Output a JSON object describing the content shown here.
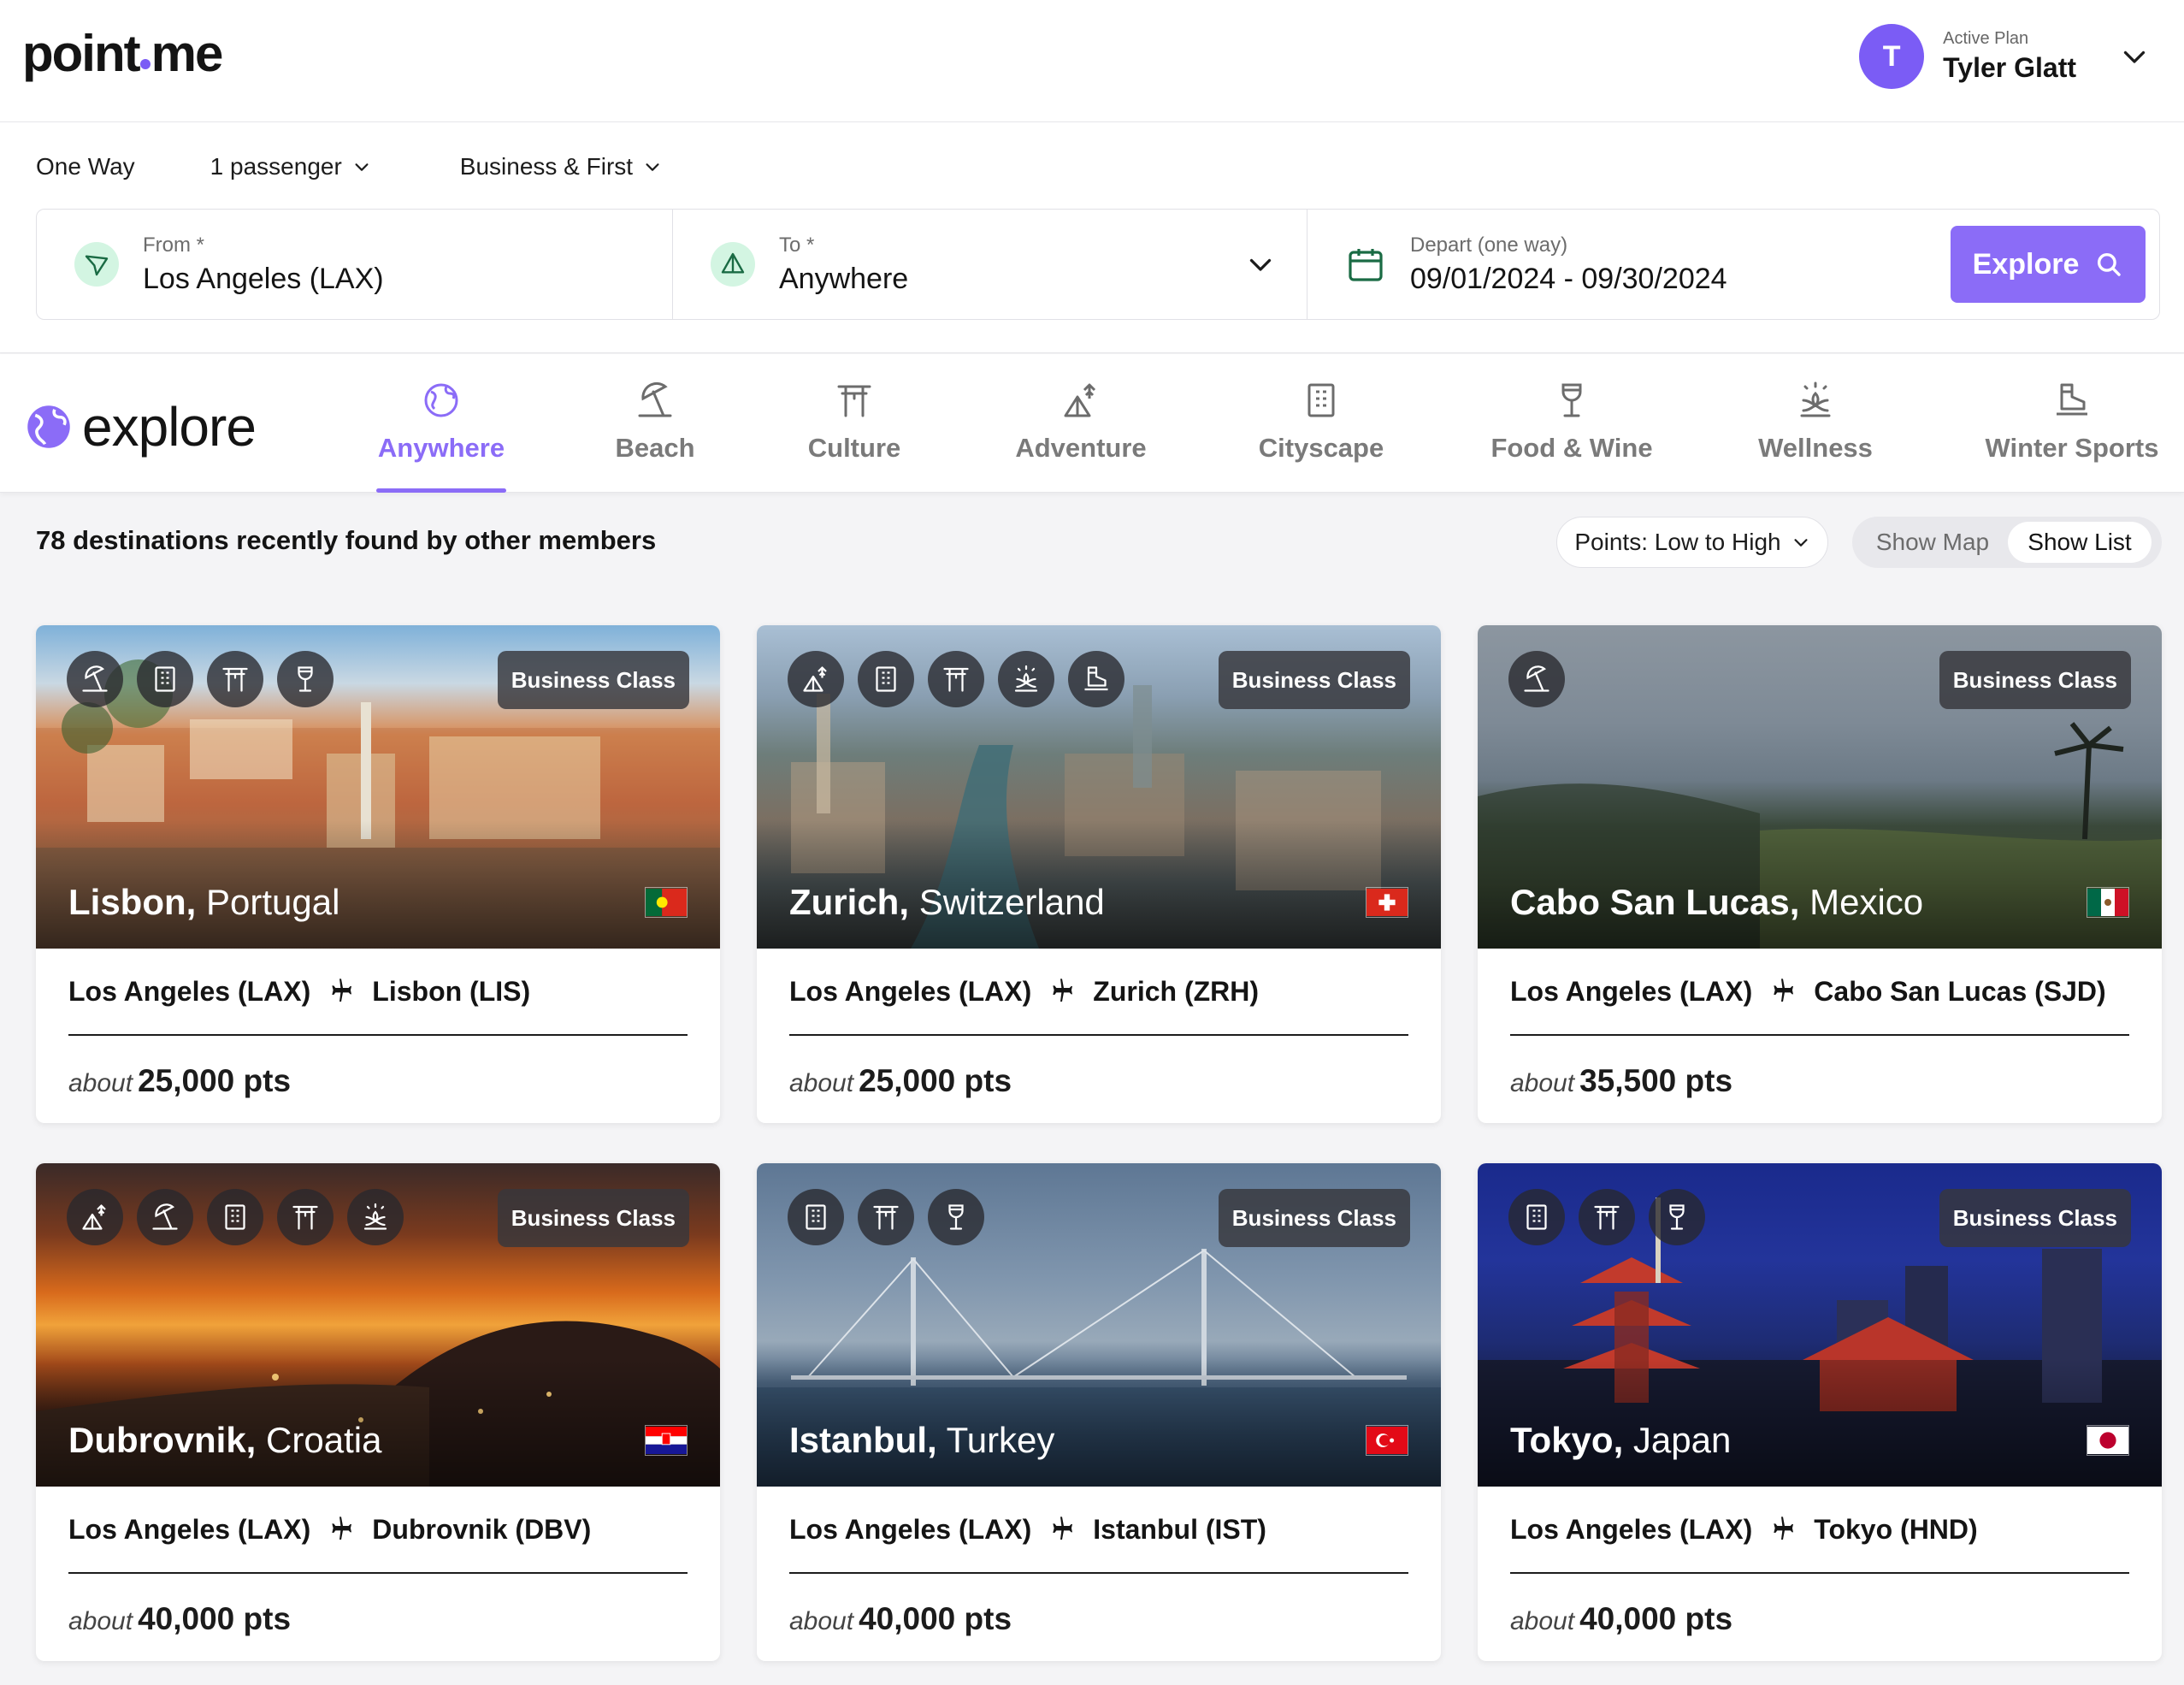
{
  "header": {
    "logo": "point.me",
    "logo_left": "point",
    "logo_right": "me",
    "user_initial": "T",
    "plan_label": "Active Plan",
    "user_name": "Tyler Glatt"
  },
  "search": {
    "trip_type": "One Way",
    "passengers": "1 passenger",
    "cabin": "Business & First",
    "from_label": "From *",
    "from_value": "Los Angeles (LAX)",
    "to_label": "To *",
    "to_value": "Anywhere",
    "date_label": "Depart (one way)",
    "date_value": "09/01/2024 - 09/30/2024",
    "explore_label": "Explore"
  },
  "explore": {
    "brand": "explore",
    "categories": [
      {
        "label": "Anywhere",
        "icon": "globe-icon",
        "active": true
      },
      {
        "label": "Beach",
        "icon": "beach-umbrella-icon",
        "active": false
      },
      {
        "label": "Culture",
        "icon": "torii-gate-icon",
        "active": false
      },
      {
        "label": "Adventure",
        "icon": "camping-icon",
        "active": false
      },
      {
        "label": "Cityscape",
        "icon": "building-icon",
        "active": false
      },
      {
        "label": "Food & Wine",
        "icon": "wine-glass-icon",
        "active": false
      },
      {
        "label": "Wellness",
        "icon": "lotus-icon",
        "active": false
      },
      {
        "label": "Winter Sports",
        "icon": "ski-boot-icon",
        "active": false
      }
    ]
  },
  "results": {
    "title": "78 destinations recently found by other members",
    "sort_label": "Points: Low to High",
    "show_map": "Show Map",
    "show_list": "Show List"
  },
  "colors": {
    "accent": "#8b6cf7",
    "seg_icon_bg": "#d3f5e2"
  },
  "cards": [
    {
      "city": "Lisbon,",
      "country": "Portugal",
      "badge": "Business Class",
      "from": "Los Angeles (LAX)",
      "to": "Lisbon (LIS)",
      "about": "about",
      "points": "25,000 pts",
      "icons": [
        "beach-umbrella-icon",
        "building-icon",
        "torii-gate-icon",
        "wine-glass-icon"
      ],
      "flag": "portugal-flag"
    },
    {
      "city": "Zurich,",
      "country": "Switzerland",
      "badge": "Business Class",
      "from": "Los Angeles (LAX)",
      "to": "Zurich (ZRH)",
      "about": "about",
      "points": "25,000 pts",
      "icons": [
        "camping-icon",
        "building-icon",
        "torii-gate-icon",
        "lotus-icon",
        "ski-boot-icon"
      ],
      "flag": "switzerland-flag"
    },
    {
      "city": "Cabo San Lucas,",
      "country": "Mexico",
      "badge": "Business Class",
      "from": "Los Angeles (LAX)",
      "to": "Cabo San Lucas (SJD)",
      "about": "about",
      "points": "35,500 pts",
      "icons": [
        "beach-umbrella-icon"
      ],
      "flag": "mexico-flag"
    },
    {
      "city": "Dubrovnik,",
      "country": "Croatia",
      "badge": "Business Class",
      "from": "Los Angeles (LAX)",
      "to": "Dubrovnik (DBV)",
      "about": "about",
      "points": "40,000 pts",
      "icons": [
        "camping-icon",
        "beach-umbrella-icon",
        "building-icon",
        "torii-gate-icon",
        "lotus-icon"
      ],
      "flag": "croatia-flag"
    },
    {
      "city": "Istanbul,",
      "country": "Turkey",
      "badge": "Business Class",
      "from": "Los Angeles (LAX)",
      "to": "Istanbul (IST)",
      "about": "about",
      "points": "40,000 pts",
      "icons": [
        "building-icon",
        "torii-gate-icon",
        "wine-glass-icon"
      ],
      "flag": "turkey-flag"
    },
    {
      "city": "Tokyo,",
      "country": "Japan",
      "badge": "Business Class",
      "from": "Los Angeles (LAX)",
      "to": "Tokyo (HND)",
      "about": "about",
      "points": "40,000 pts",
      "icons": [
        "building-icon",
        "torii-gate-icon",
        "wine-glass-icon"
      ],
      "flag": "japan-flag"
    }
  ]
}
